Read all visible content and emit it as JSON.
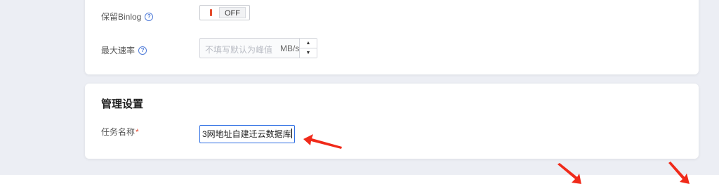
{
  "general_card": {
    "binlog": {
      "label": "保留Binlog",
      "help_icon": "help-circle-icon",
      "state": "OFF",
      "enabled": false
    },
    "max_rate": {
      "label": "最大速率",
      "help_icon": "help-circle-icon",
      "placeholder": "不填写默认为峰值",
      "unit": "MB/s"
    }
  },
  "manage_card": {
    "title": "管理设置",
    "task_name": {
      "label": "任务名称",
      "required_mark": "*",
      "value": "3网地址自建迁云数据库"
    }
  },
  "colors": {
    "accent": "#2f6fe4",
    "toggle_off_marker": "#e44b2c",
    "annotation_arrow": "#f02a1a",
    "required": "#e5533b"
  },
  "annotations": [
    "red-arrow-icon",
    "red-arrow-icon",
    "red-arrow-icon"
  ]
}
